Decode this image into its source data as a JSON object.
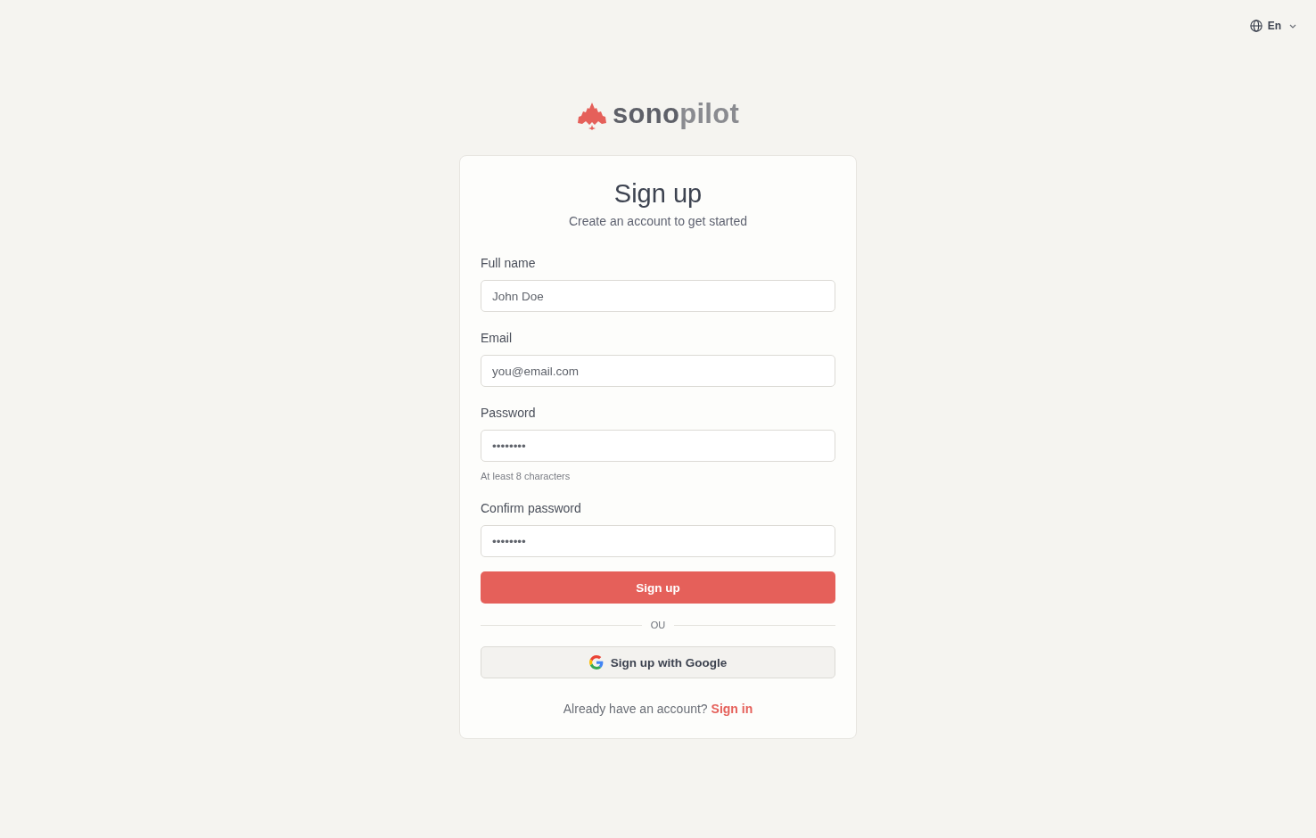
{
  "language_selector": {
    "label": "En"
  },
  "logo": {
    "wordmark": [
      "sono",
      "pilot"
    ]
  },
  "card": {
    "title": "Sign up",
    "subtitle": "Create an account to get started",
    "fields": [
      {
        "label": "Full name",
        "placeholder": "John Doe"
      },
      {
        "label": "Email",
        "placeholder": "you@email.com"
      },
      {
        "label": "Password",
        "placeholder": "••••••••",
        "hint": "At least 8 characters"
      },
      {
        "label": "Confirm password",
        "placeholder": "••••••••"
      }
    ],
    "submit_button": "Sign up",
    "divider": "OU",
    "google_button": "Sign up with Google",
    "footer": {
      "text": "Already have an account?",
      "link": "Sign in"
    }
  }
}
